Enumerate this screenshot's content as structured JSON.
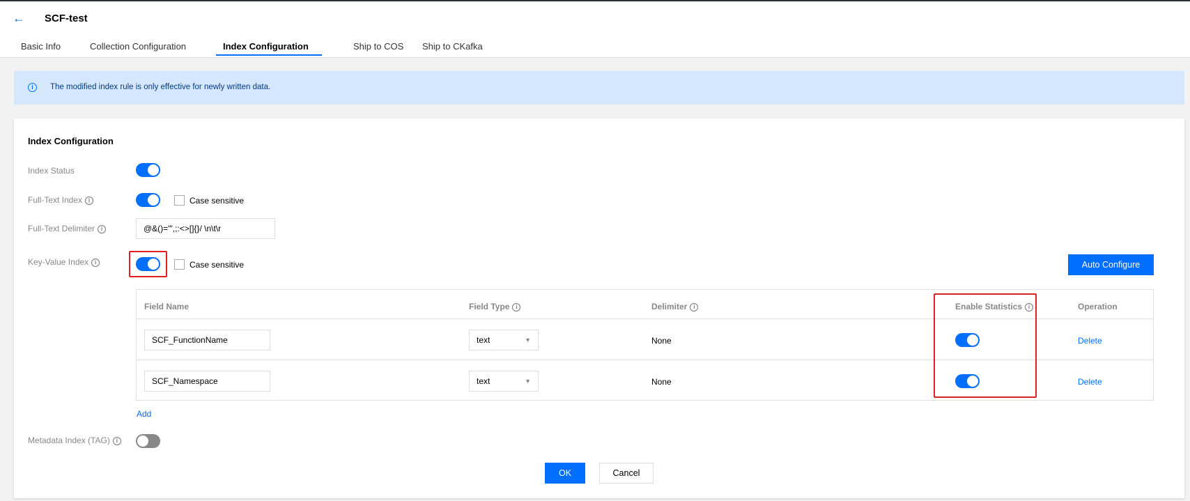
{
  "header": {
    "title": "SCF-test",
    "back_icon": "arrow-left-icon"
  },
  "tabs": [
    {
      "label": "Basic Info"
    },
    {
      "label": "Collection Configuration"
    },
    {
      "label": "Index Configuration",
      "active": true
    },
    {
      "label": "Ship to COS"
    },
    {
      "label": "Ship to CKafka"
    }
  ],
  "banner": {
    "text": "The modified index rule is only effective for newly written data.",
    "icon": "i"
  },
  "section": {
    "title": "Index Configuration"
  },
  "form": {
    "index_status": {
      "label": "Index Status",
      "enabled": true
    },
    "full_text": {
      "label": "Full-Text Index",
      "enabled": true,
      "case_label": "Case sensitive",
      "case_checked": false
    },
    "delimiter": {
      "label": "Full-Text Delimiter",
      "value": "@&()='\",;:<>[]{}/ \\n\\t\\r"
    },
    "key_value": {
      "label": "Key-Value Index",
      "enabled": true,
      "case_label": "Case sensitive",
      "case_checked": false
    },
    "metadata": {
      "label": "Metadata Index (TAG)",
      "enabled": false
    }
  },
  "auto_configure": "Auto Configure",
  "table": {
    "headers": {
      "field_name": "Field Name",
      "field_type": "Field Type",
      "delimiter": "Delimiter",
      "stats": "Enable Statistics",
      "operation": "Operation"
    },
    "rows": [
      {
        "field_name": "SCF_FunctionName",
        "field_type": "text",
        "delimiter": "None",
        "stats": true,
        "operation": "Delete"
      },
      {
        "field_name": "SCF_Namespace",
        "field_type": "text",
        "delimiter": "None",
        "stats": true,
        "operation": "Delete"
      }
    ]
  },
  "add": "Add",
  "info_glyph": "i",
  "caret": "▼",
  "footer": {
    "ok": "OK",
    "cancel": "Cancel"
  },
  "colors": {
    "primary": "#006eff",
    "highlight": "#e02020",
    "banner": "#d5e7fd"
  }
}
